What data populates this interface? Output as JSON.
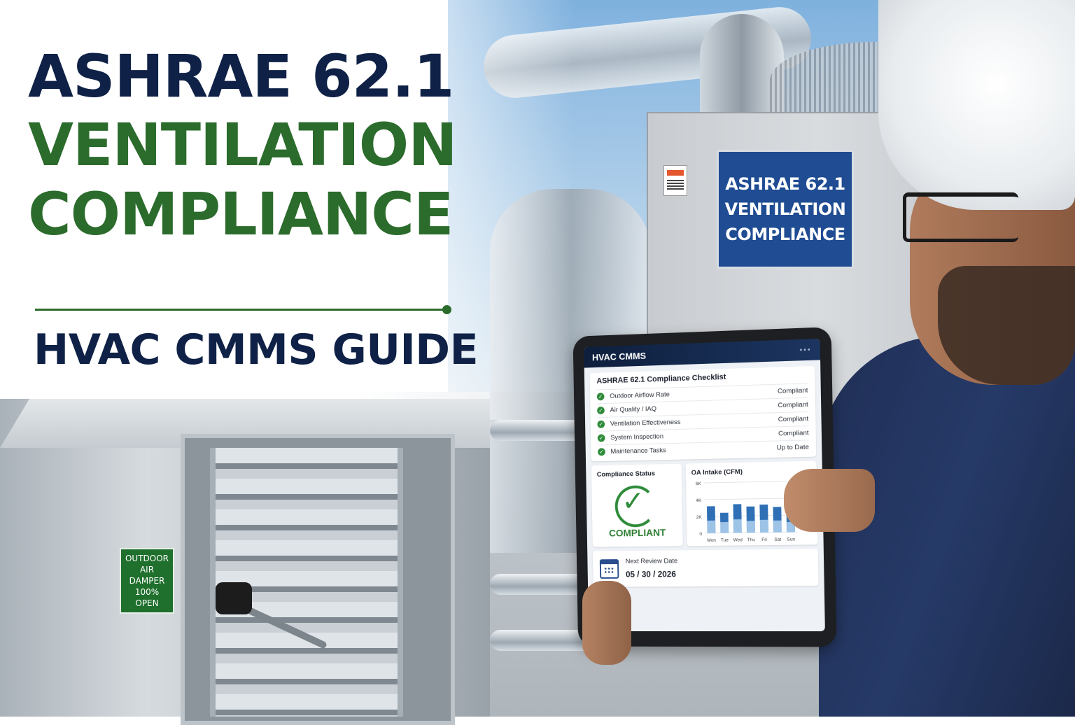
{
  "headline": {
    "line1": "ASHRAE 62.1",
    "line2": "VENTILATION",
    "line3": "COMPLIANCE",
    "subtitle": "HVAC CMMS GUIDE"
  },
  "cabinet_sign": {
    "line1": "ASHRAE 62.1",
    "line2": "VENTILATION",
    "line3": "COMPLIANCE"
  },
  "damper_label": {
    "line1": "OUTDOOR",
    "line2": "AIR DAMPER",
    "line3": "100%",
    "line4": "OPEN"
  },
  "tablet": {
    "app_name": "HVAC CMMS",
    "checklist_title": "ASHRAE 62.1 Compliance Checklist",
    "checklist": [
      {
        "item": "Outdoor Airflow Rate",
        "status": "Compliant"
      },
      {
        "item": "Air Quality / IAQ",
        "status": "Compliant"
      },
      {
        "item": "Ventilation Effectiveness",
        "status": "Compliant"
      },
      {
        "item": "System Inspection",
        "status": "Compliant"
      },
      {
        "item": "Maintenance Tasks",
        "status": "Up to Date"
      }
    ],
    "status_panel_title": "Compliance Status",
    "status_value": "COMPLIANT",
    "chart_title": "OA Intake (CFM)",
    "review_label": "Next Review Date",
    "review_date": "05 / 30 / 2026"
  },
  "chart_data": {
    "type": "bar",
    "title": "OA Intake (CFM)",
    "categories": [
      "Mon",
      "Tue",
      "Wed",
      "Thu",
      "Fri",
      "Sat",
      "Sun"
    ],
    "series": [
      {
        "values": [
          3200,
          2400,
          3400,
          3100,
          3300,
          3000,
          2200
        ]
      },
      {
        "values": [
          1500,
          1300,
          1600,
          1400,
          1500,
          1400,
          1200
        ]
      }
    ],
    "ytick_labels": [
      "0",
      "2K",
      "4K",
      "6K"
    ],
    "ylim": [
      0,
      6000
    ],
    "colors": [
      "#2f6fb5",
      "#9dc3e6"
    ]
  },
  "colors": {
    "navy": "#0f2146",
    "green": "#2b6b2c",
    "sign_blue": "#1f4c92",
    "label_green": "#1f6f2d"
  }
}
